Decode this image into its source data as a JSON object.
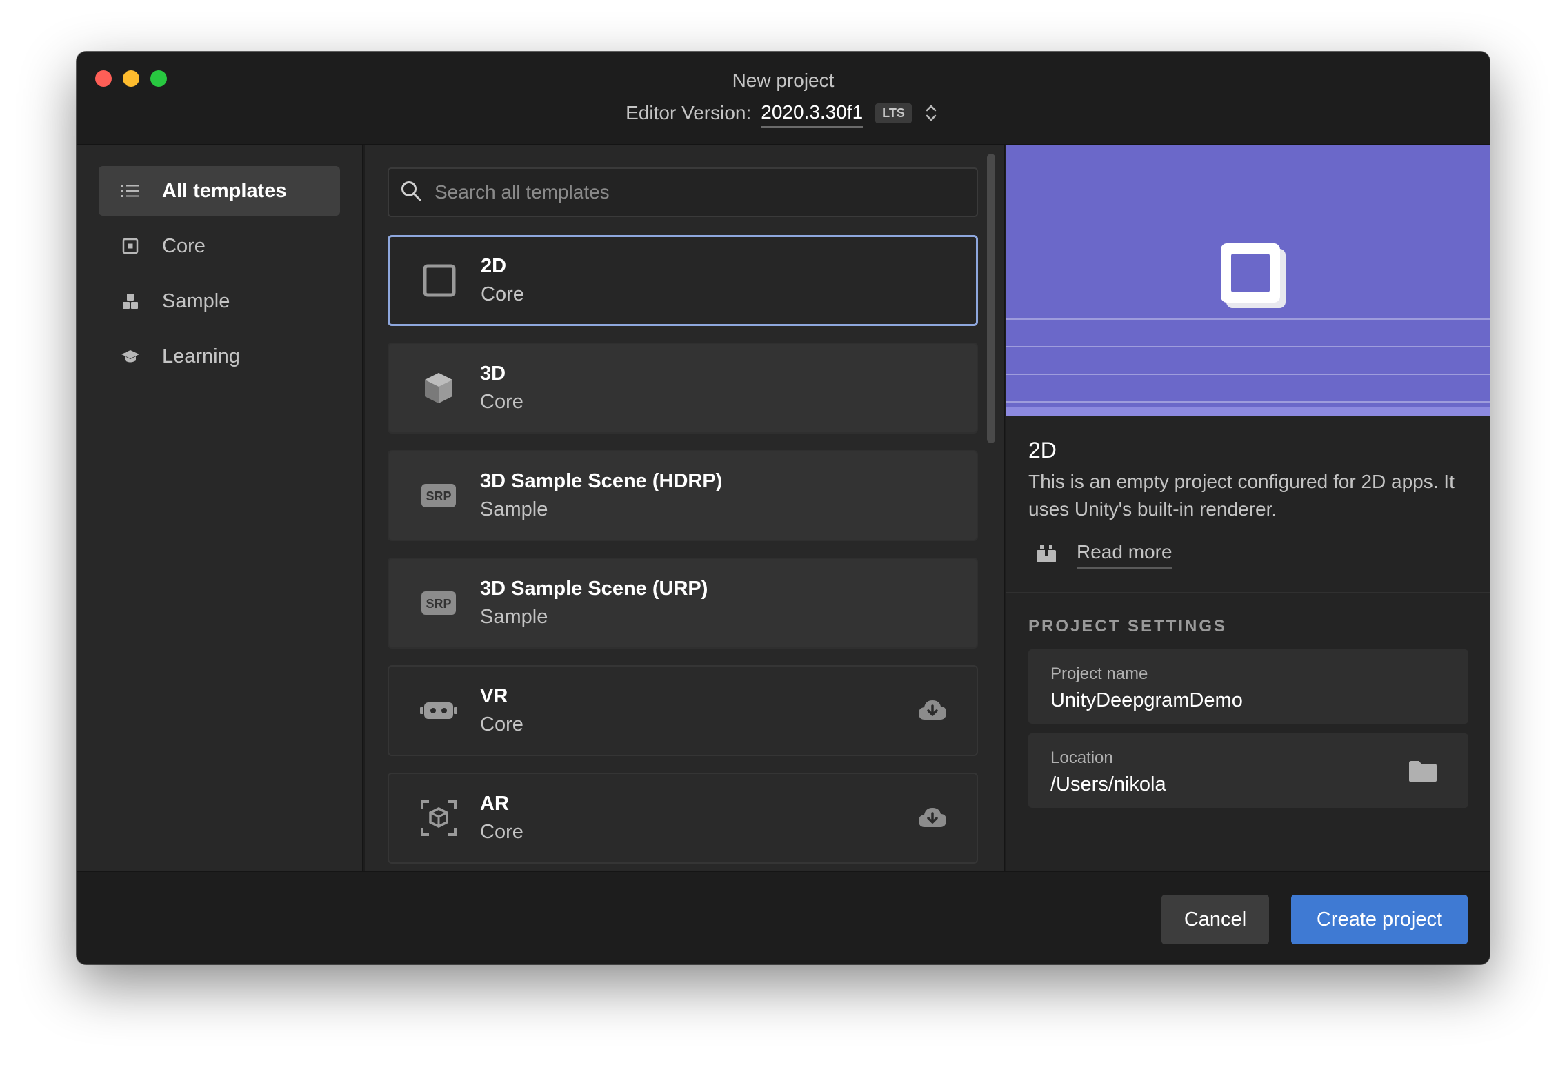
{
  "window": {
    "title": "New project",
    "editor_version_label": "Editor Version:",
    "editor_version": "2020.3.30f1",
    "lts_badge": "LTS"
  },
  "sidebar": {
    "items": [
      {
        "label": "All templates",
        "icon": "list-icon",
        "active": true
      },
      {
        "label": "Core",
        "icon": "core-icon",
        "active": false
      },
      {
        "label": "Sample",
        "icon": "sample-icon",
        "active": false
      },
      {
        "label": "Learning",
        "icon": "graduation-cap-icon",
        "active": false
      }
    ]
  },
  "search": {
    "placeholder": "Search all templates",
    "value": ""
  },
  "templates": [
    {
      "name": "2D",
      "category": "Core",
      "icon": "square-2d-icon",
      "selected": true,
      "download": false
    },
    {
      "name": "3D",
      "category": "Core",
      "icon": "cube-icon",
      "selected": false,
      "download": false
    },
    {
      "name": "3D Sample Scene (HDRP)",
      "category": "Sample",
      "icon": "srp-icon",
      "icon_text": "SRP",
      "selected": false,
      "download": false
    },
    {
      "name": "3D Sample Scene (URP)",
      "category": "Sample",
      "icon": "srp-icon",
      "icon_text": "SRP",
      "selected": false,
      "download": false
    },
    {
      "name": "VR",
      "category": "Core",
      "icon": "vr-headset-icon",
      "selected": false,
      "download": true
    },
    {
      "name": "AR",
      "category": "Core",
      "icon": "ar-cube-icon",
      "selected": false,
      "download": true
    }
  ],
  "details": {
    "title": "2D",
    "description": "This is an empty project configured for 2D apps. It uses Unity's built-in renderer.",
    "read_more": "Read more",
    "settings_heading": "PROJECT SETTINGS",
    "project_name_label": "Project name",
    "project_name_value": "UnityDeepgramDemo",
    "location_label": "Location",
    "location_value": "/Users/nikola"
  },
  "footer": {
    "cancel_label": "Cancel",
    "create_label": "Create project"
  },
  "colors": {
    "accent": "#3f7ad3",
    "preview_bg": "#6b68c9",
    "selection_border": "#8ea7dd",
    "close": "#fe5f57",
    "minimize": "#febc2e",
    "zoom": "#28c840"
  }
}
